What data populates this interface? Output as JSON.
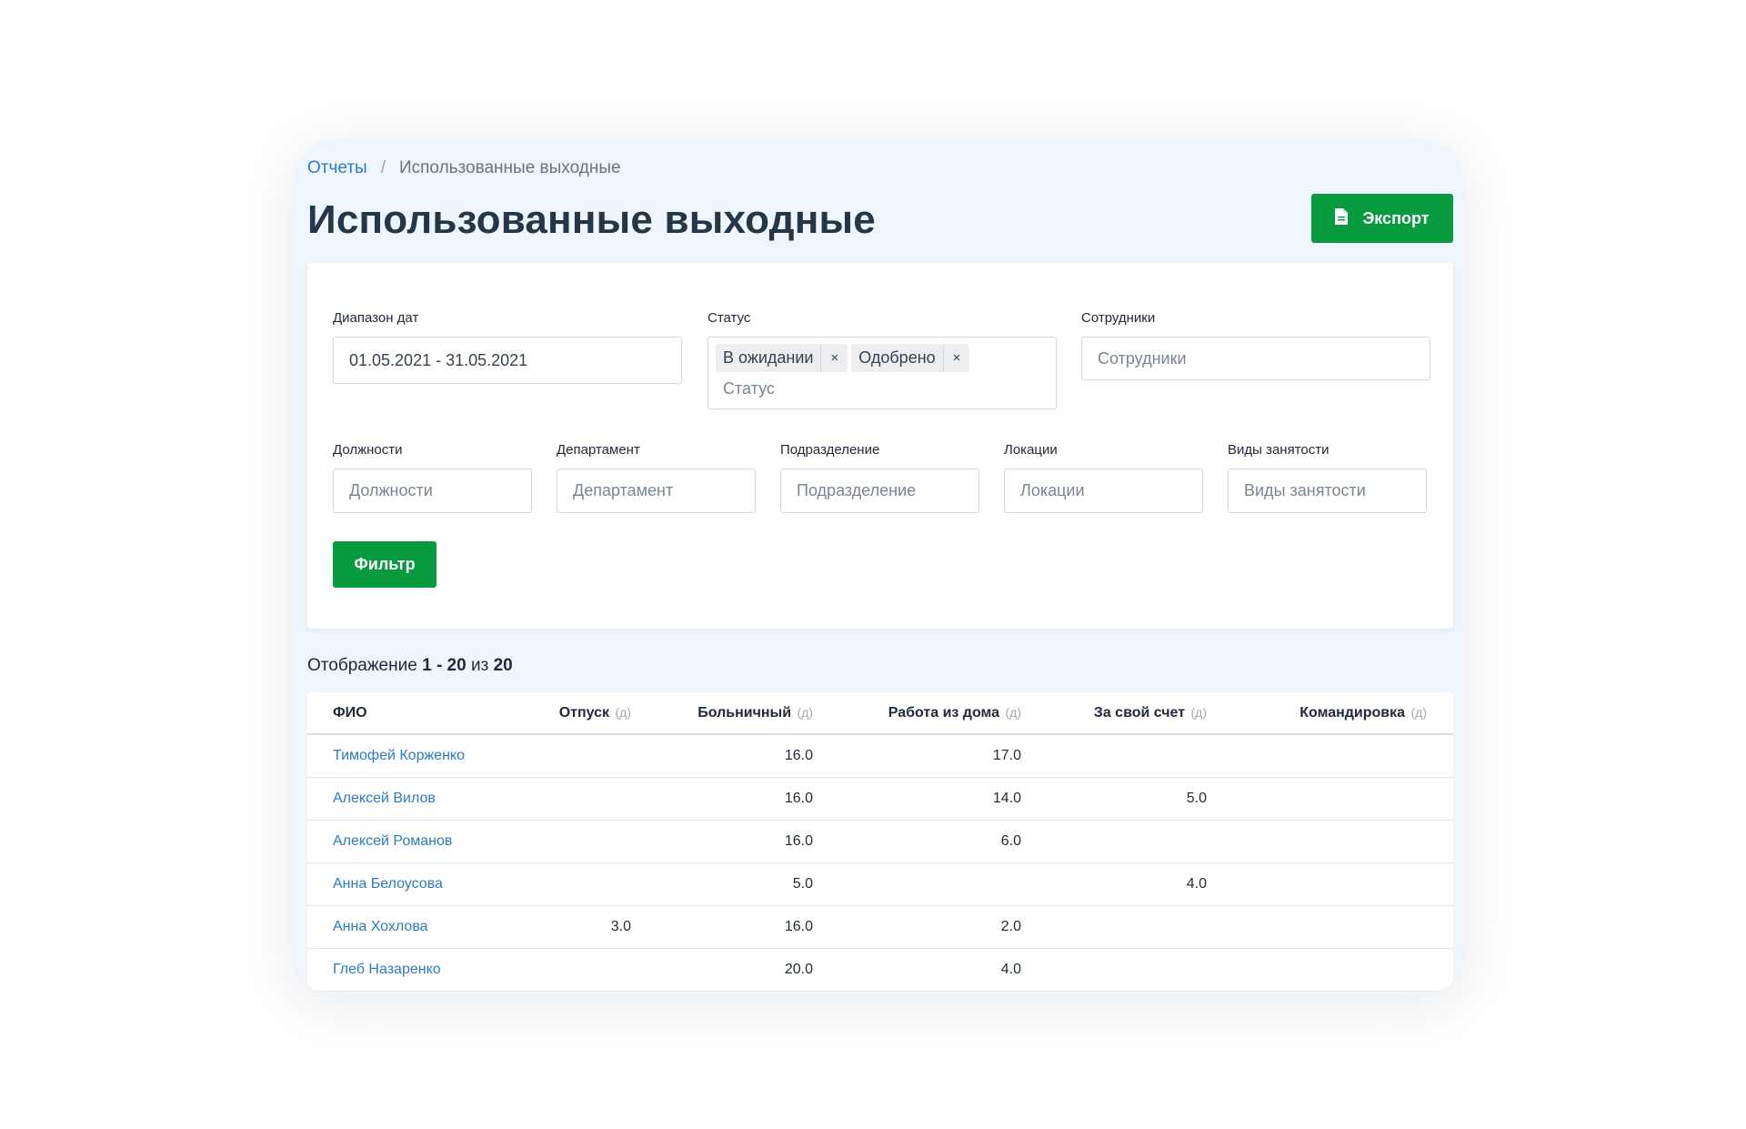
{
  "breadcrumb": {
    "parent": "Отчеты",
    "separator": "/",
    "current": "Использованные выходные"
  },
  "page": {
    "title": "Использованные выходные"
  },
  "export_button": {
    "label": "Экспорт",
    "icon": "file-icon"
  },
  "filters": {
    "date_range": {
      "label": "Диапазон дат",
      "value": "01.05.2021 - 31.05.2021"
    },
    "status": {
      "label": "Статус",
      "placeholder": "Статус",
      "chips": [
        {
          "label": "В ожидании",
          "remove": "×"
        },
        {
          "label": "Одобрено",
          "remove": "×"
        }
      ]
    },
    "employees": {
      "label": "Сотрудники",
      "placeholder": "Сотрудники"
    },
    "positions": {
      "label": "Должности",
      "placeholder": "Должности"
    },
    "department": {
      "label": "Департамент",
      "placeholder": "Департамент"
    },
    "division": {
      "label": "Подразделение",
      "placeholder": "Подразделение"
    },
    "locations": {
      "label": "Локации",
      "placeholder": "Локации"
    },
    "employment_types": {
      "label": "Виды занятости",
      "placeholder": "Виды занятости"
    },
    "filter_button": "Фильтр"
  },
  "showing": {
    "prefix": "Отображение",
    "range": "1 - 20",
    "of": "из",
    "total": "20"
  },
  "table": {
    "columns": [
      {
        "label": "ФИО",
        "unit": ""
      },
      {
        "label": "Отпуск",
        "unit": "(д)"
      },
      {
        "label": "Больничный",
        "unit": "(д)"
      },
      {
        "label": "Работа из дома",
        "unit": "(д)"
      },
      {
        "label": "За свой счет",
        "unit": "(д)"
      },
      {
        "label": "Командировка",
        "unit": "(д)"
      }
    ],
    "rows": [
      {
        "name": "Тимофей Корженко",
        "vacation": "",
        "sick": "16.0",
        "remote": "17.0",
        "unpaid": "",
        "trip": ""
      },
      {
        "name": "Алексей Вилов",
        "vacation": "",
        "sick": "16.0",
        "remote": "14.0",
        "unpaid": "5.0",
        "trip": ""
      },
      {
        "name": "Алексей Романов",
        "vacation": "",
        "sick": "16.0",
        "remote": "6.0",
        "unpaid": "",
        "trip": ""
      },
      {
        "name": "Анна Белоусова",
        "vacation": "",
        "sick": "5.0",
        "remote": "",
        "unpaid": "4.0",
        "trip": ""
      },
      {
        "name": "Анна Хохлова",
        "vacation": "3.0",
        "sick": "16.0",
        "remote": "2.0",
        "unpaid": "",
        "trip": ""
      },
      {
        "name": "Глеб Назаренко",
        "vacation": "",
        "sick": "20.0",
        "remote": "4.0",
        "unpaid": "",
        "trip": ""
      }
    ]
  },
  "colors": {
    "accent_green": "#089a3e",
    "link_blue": "#2a7bc3",
    "title": "#253746",
    "frame_bg": "#eef5fd"
  }
}
